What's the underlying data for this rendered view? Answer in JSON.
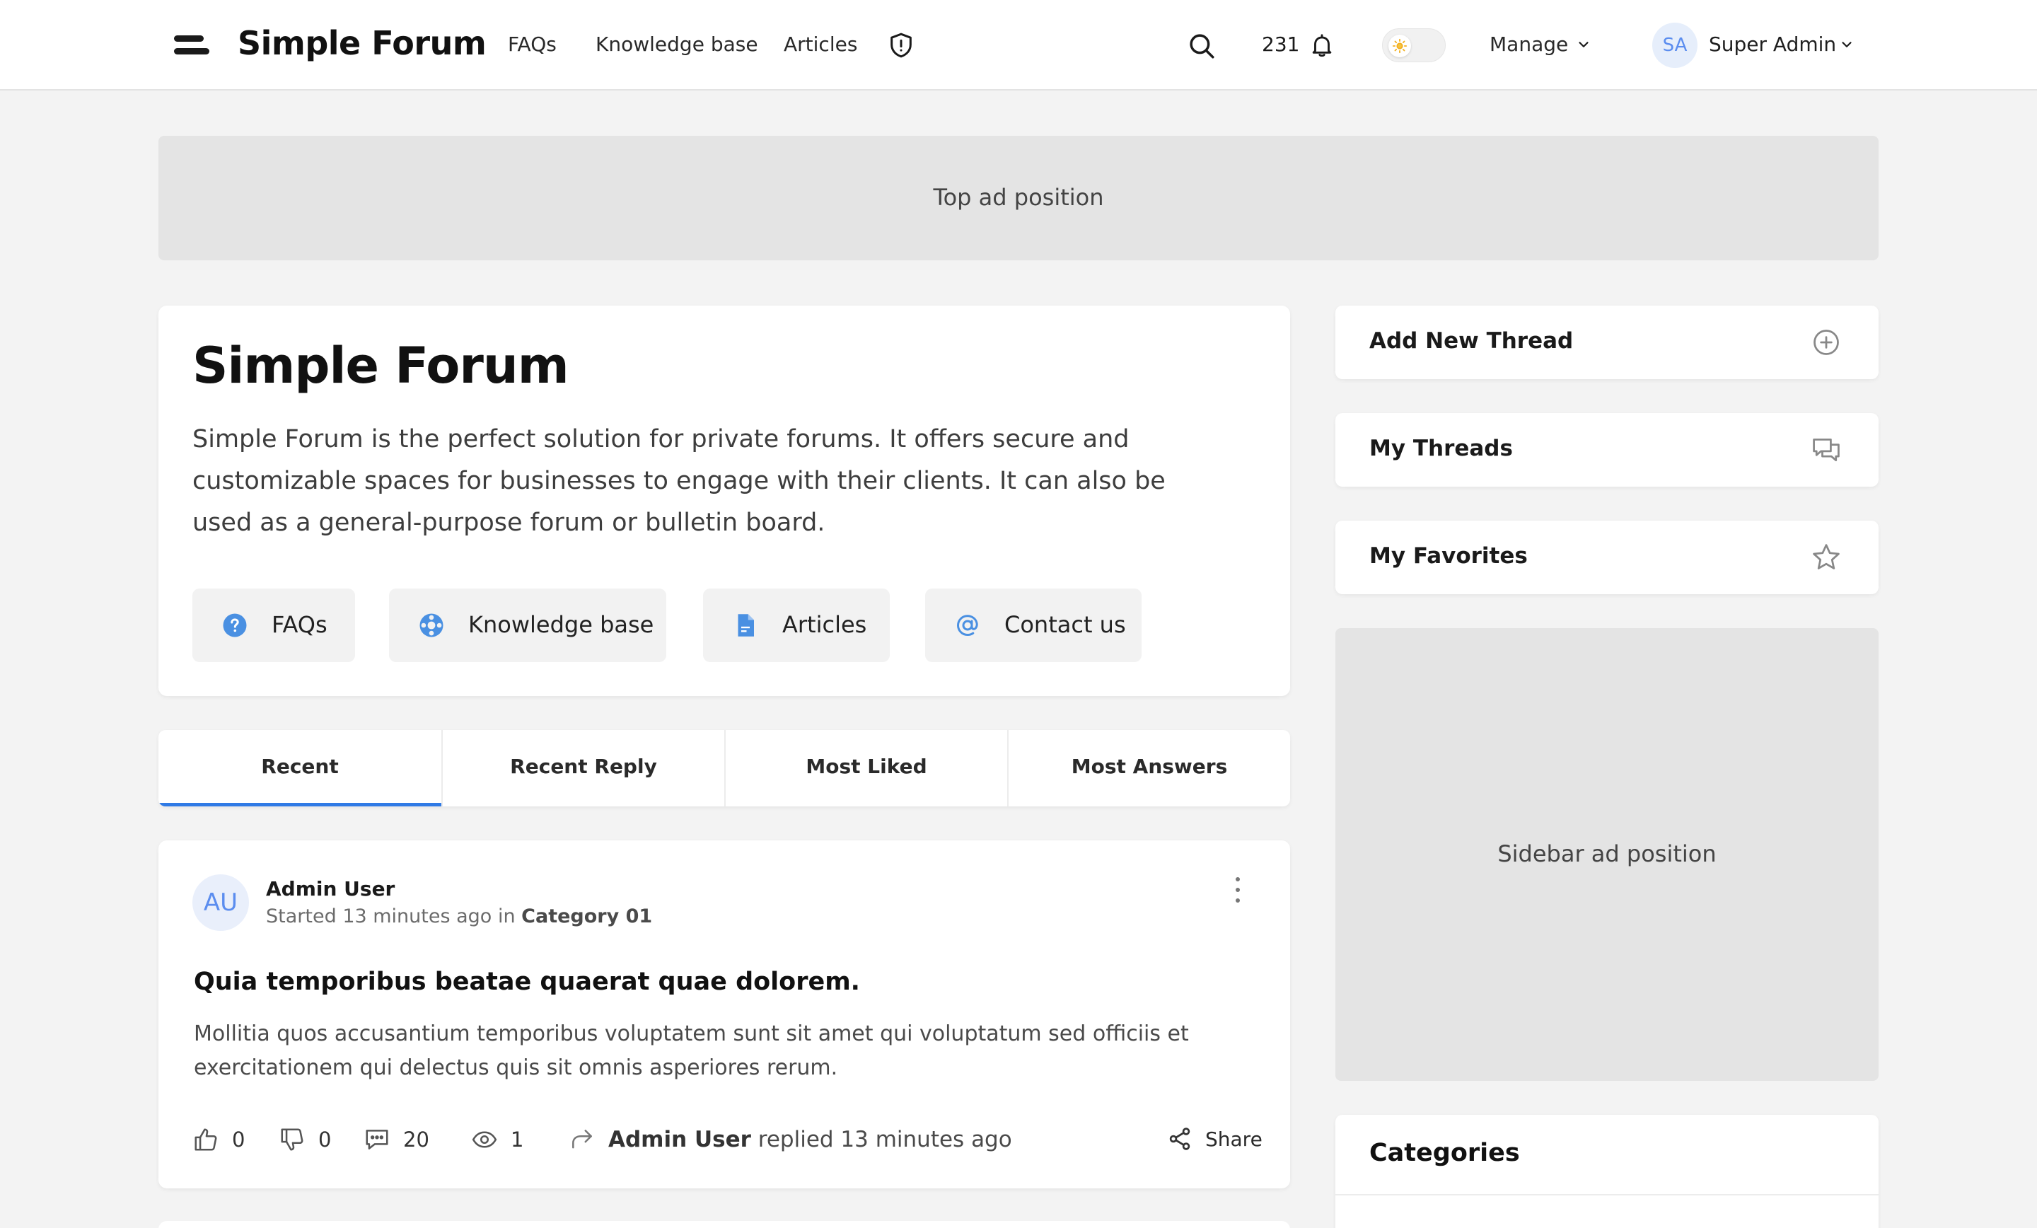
{
  "header": {
    "brand": "Simple Forum",
    "nav": [
      "FAQs",
      "Knowledge base",
      "Articles"
    ],
    "notifications_count": "231",
    "manage_label": "Manage",
    "user_initials": "SA",
    "user_name": "Super Admin"
  },
  "ads": {
    "top": "Top ad position",
    "sidebar": "Sidebar ad position"
  },
  "hero": {
    "title": "Simple Forum",
    "description": "Simple Forum is the perfect solution for private forums. It offers secure and customizable spaces for businesses to engage with their clients. It can also be used as a general-purpose forum or bulletin board.",
    "buttons": [
      {
        "label": "FAQs",
        "icon": "question-circle-icon"
      },
      {
        "label": "Knowledge base",
        "icon": "lifebuoy-icon"
      },
      {
        "label": "Articles",
        "icon": "document-icon"
      },
      {
        "label": "Contact us",
        "icon": "at-sign-icon"
      }
    ]
  },
  "tabs": [
    "Recent",
    "Recent Reply",
    "Most Liked",
    "Most Answers"
  ],
  "active_tab": "Recent",
  "thread": {
    "author_initials": "AU",
    "author": "Admin User",
    "started_prefix": "Started",
    "started_time": "13 minutes ago",
    "in_word": "in",
    "category": "Category 01",
    "title": "Quia temporibus beatae quaerat quae dolorem.",
    "body": "Mollitia quos accusantium temporibus voluptatem sunt sit amet qui voluptatum sed officiis et exercitationem qui delectus quis sit omnis asperiores rerum.",
    "likes": "0",
    "dislikes": "0",
    "comments": "20",
    "views": "1",
    "last_reply_user": "Admin User",
    "last_reply_text": "replied 13 minutes ago",
    "share_label": "Share"
  },
  "sidebar": {
    "add_thread": "Add New Thread",
    "my_threads": "My Threads",
    "my_favorites": "My Favorites",
    "categories_title": "Categories"
  },
  "colors": {
    "accent": "#2f7ae5",
    "icon_blue": "#4a90e2",
    "avatar_bg": "#e6eefb",
    "ad_bg": "#e4e4e4",
    "page_bg": "#f3f3f3"
  }
}
